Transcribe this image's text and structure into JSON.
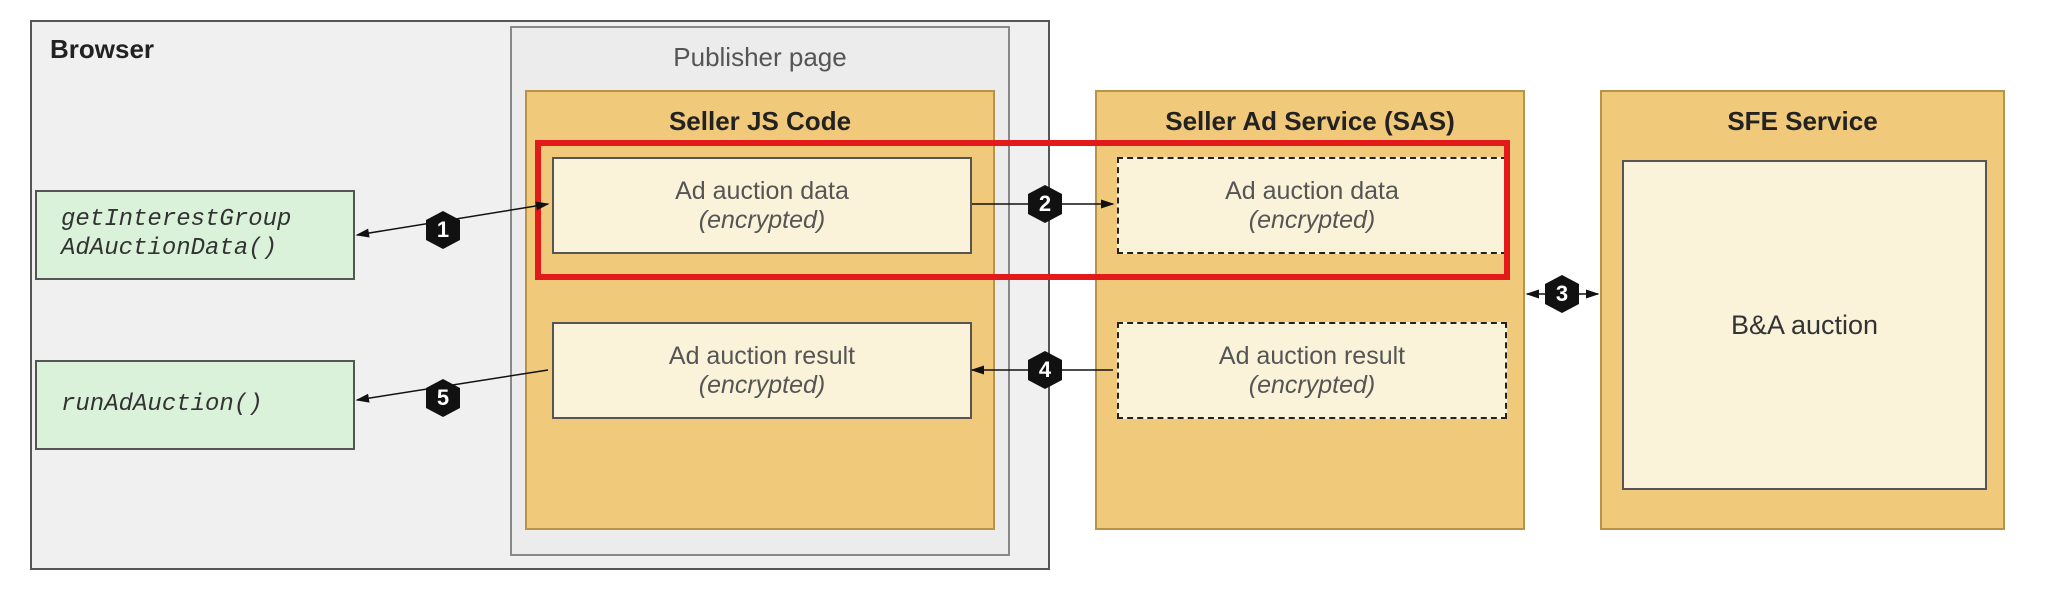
{
  "browser": {
    "label": "Browser"
  },
  "publisher": {
    "label": "Publisher page"
  },
  "seller_js": {
    "title": "Seller JS Code"
  },
  "sas": {
    "title": "Seller Ad Service (SAS)"
  },
  "sfe": {
    "title": "SFE Service",
    "box": "B&A auction"
  },
  "api1": {
    "text": "getInterestGroup\nAdAuctionData()"
  },
  "api2": {
    "text": "runAdAuction()"
  },
  "data_top": {
    "line1": "Ad auction data",
    "line2": "(encrypted)"
  },
  "data_bot": {
    "line1": "Ad auction result",
    "line2": "(encrypted)"
  },
  "steps": {
    "s1": "1",
    "s2": "2",
    "s3": "3",
    "s4": "4",
    "s5": "5"
  }
}
